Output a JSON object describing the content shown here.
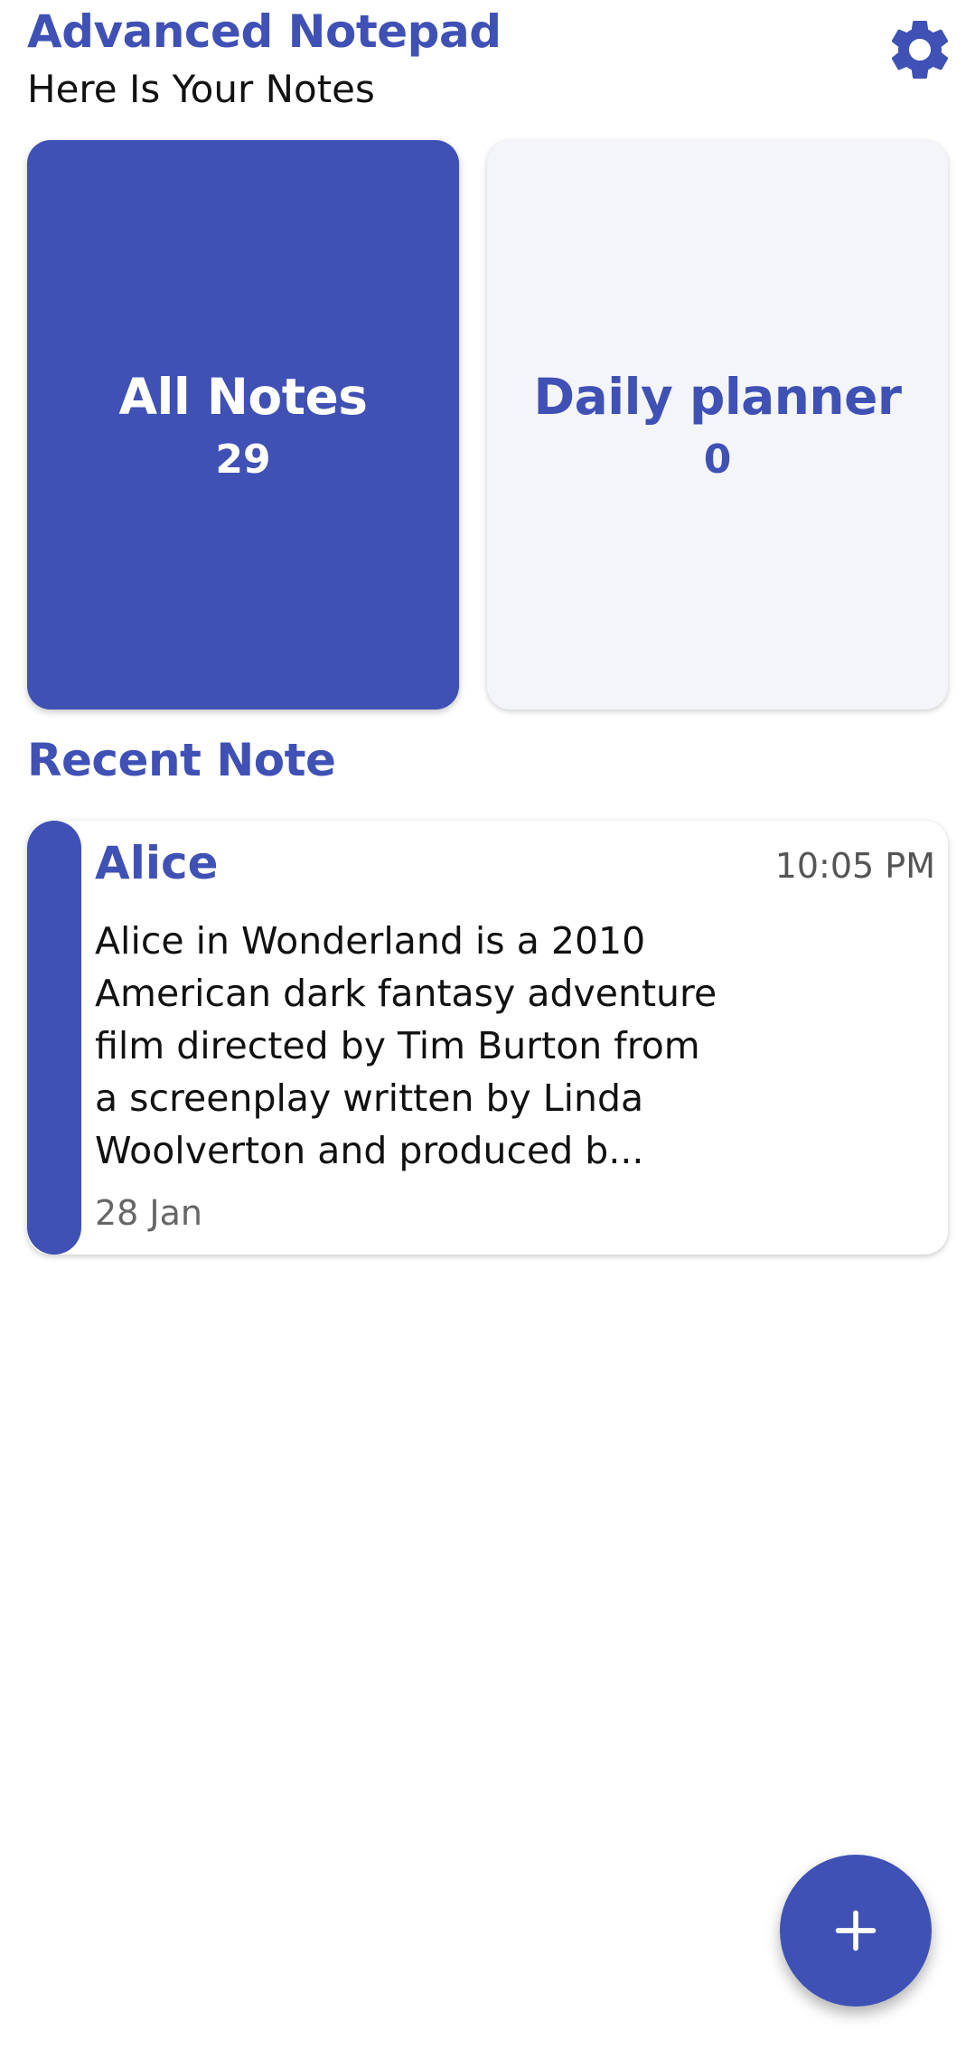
{
  "header": {
    "title": "Advanced Notepad",
    "subtitle": "Here Is Your Notes",
    "settings_icon": "gear-icon"
  },
  "tiles": [
    {
      "label": "All Notes",
      "count": "29"
    },
    {
      "label": "Daily planner",
      "count": "0"
    }
  ],
  "recent": {
    "heading": "Recent Note",
    "note": {
      "title": "Alice",
      "time": "10:05 PM",
      "lines": [
        "Alice in Wonderland is a 2010",
        "American dark fantasy adventure",
        "film directed by Tim Burton from",
        "a screenplay written by Linda",
        "Woolverton and produced b..."
      ],
      "date": "28 Jan"
    }
  },
  "fab": {
    "icon": "plus-icon"
  },
  "colors": {
    "accent": "#3F51B5",
    "tile_light": "#F4F5F9",
    "text_dark": "#111111",
    "text_muted": "#666666"
  }
}
